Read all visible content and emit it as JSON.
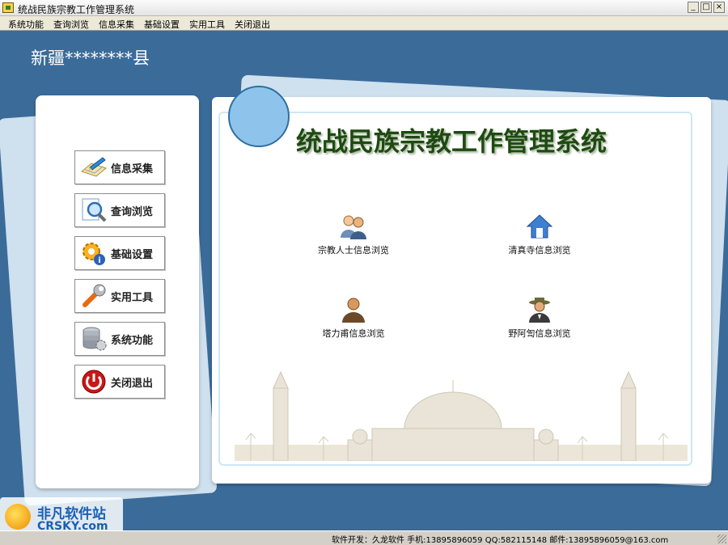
{
  "window": {
    "title": "统战民族宗教工作管理系统",
    "min": "_",
    "max": "□",
    "close": "×"
  },
  "menu": [
    "系统功能",
    "查询浏览",
    "信息采集",
    "基础设置",
    "实用工具",
    "关闭退出"
  ],
  "county": "新疆********县",
  "nav_buttons": [
    {
      "label": "信息采集",
      "icon": "form-pencil-icon"
    },
    {
      "label": "查询浏览",
      "icon": "magnifier-icon"
    },
    {
      "label": "基础设置",
      "icon": "gear-icon"
    },
    {
      "label": "实用工具",
      "icon": "wrench-icon"
    },
    {
      "label": "系统功能",
      "icon": "database-icon"
    },
    {
      "label": "关闭退出",
      "icon": "power-icon"
    }
  ],
  "main_title": "统战民族宗教工作管理系统",
  "modules": [
    {
      "label": "宗教人士信息浏览",
      "icon": "people-icon"
    },
    {
      "label": "清真寺信息浏览",
      "icon": "house-icon"
    },
    {
      "label": "塔力甫信息浏览",
      "icon": "person-icon"
    },
    {
      "label": "野阿訇信息浏览",
      "icon": "hat-person-icon"
    }
  ],
  "status": "软件开发：久龙软件   手机:13895896059   QQ:582115148   邮件:13895896059@163.com",
  "watermark": {
    "name": "非凡软件站",
    "url": "CRSKY.com"
  }
}
